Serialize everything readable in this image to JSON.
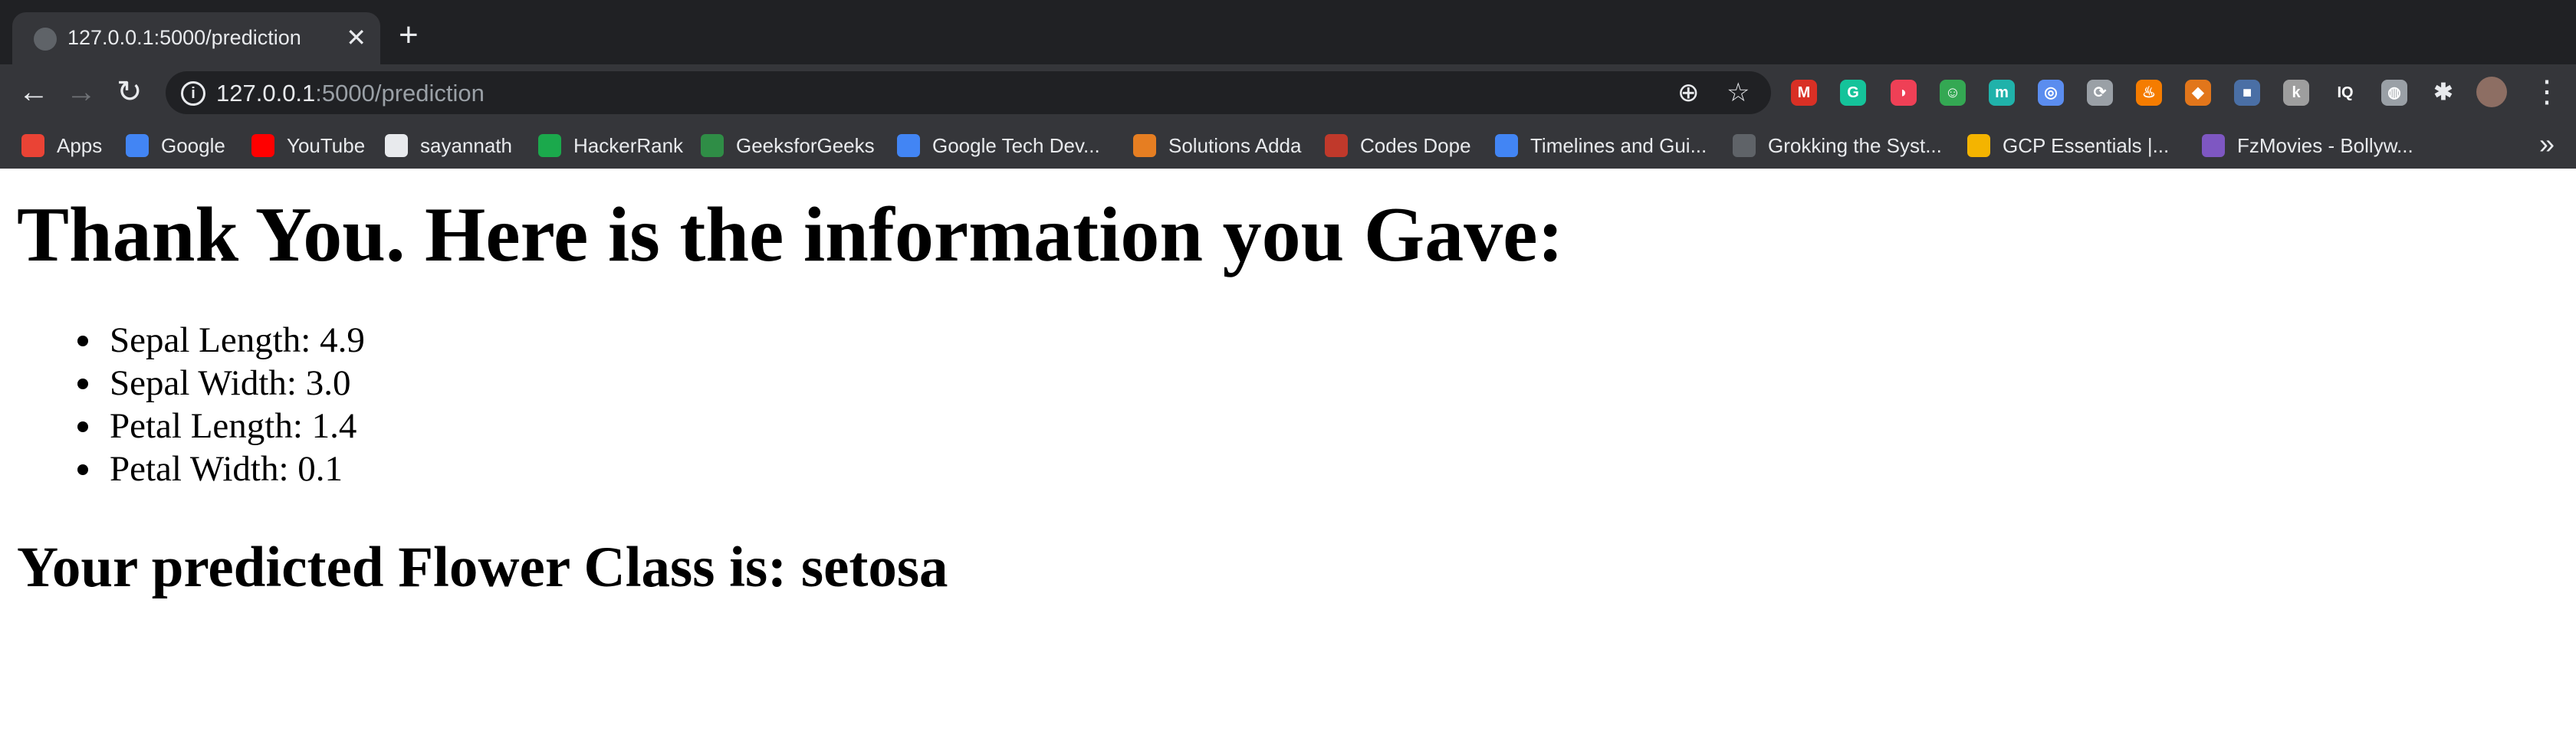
{
  "tab": {
    "title": "127.0.0.1:5000/prediction",
    "close_glyph": "✕",
    "new_tab_glyph": "+"
  },
  "toolbar": {
    "back_glyph": "←",
    "forward_glyph": "→",
    "reload_glyph": "↻",
    "info_glyph": "i",
    "url_host": "127.0.0.1",
    "url_rest": ":5000/prediction",
    "zoom_glyph": "⊕",
    "star_glyph": "☆",
    "extensions_glyph": "✱",
    "menu_glyph": "⋮"
  },
  "extensions": [
    {
      "icon": "gmail-extension-icon",
      "color": "#d93025",
      "glyph": "M"
    },
    {
      "icon": "grammarly-extension-icon",
      "color": "#15c39a",
      "glyph": "G"
    },
    {
      "icon": "pocket-extension-icon",
      "color": "#ef4056",
      "glyph": "◗"
    },
    {
      "icon": "clipboard-extension-icon",
      "color": "#34a853",
      "glyph": "☺"
    },
    {
      "icon": "m-extension-icon",
      "color": "#20b2aa",
      "glyph": "m"
    },
    {
      "icon": "mask-extension-icon",
      "color": "#5b8def",
      "glyph": "◎"
    },
    {
      "icon": "link-extension-icon",
      "color": "#9aa0a6",
      "glyph": "⟳"
    },
    {
      "icon": "fire-extension-icon",
      "color": "#f57c00",
      "glyph": "♨"
    },
    {
      "icon": "metamask-extension-icon",
      "color": "#e2761b",
      "glyph": "◆"
    },
    {
      "icon": "box-extension-icon",
      "color": "#4a6fa5",
      "glyph": "■"
    },
    {
      "icon": "k-extension-icon",
      "color": "#9e9e9e",
      "glyph": "k"
    },
    {
      "icon": "iq-extension-icon",
      "color": "#35363a",
      "glyph": "IQ"
    },
    {
      "icon": "globe-extension-icon",
      "color": "#9aa0a6",
      "glyph": "◍"
    }
  ],
  "bookmarks": [
    {
      "label": "Apps",
      "icon": "apps-grid-icon",
      "color": "#ea4335"
    },
    {
      "label": "Google",
      "icon": "google-icon",
      "color": "#4285f4"
    },
    {
      "label": "YouTube",
      "icon": "youtube-icon",
      "color": "#ff0000"
    },
    {
      "label": "sayannath",
      "icon": "github-icon",
      "color": "#e8eaed"
    },
    {
      "label": "HackerRank",
      "icon": "hackerrank-icon",
      "color": "#1ba94c"
    },
    {
      "label": "GeeksforGeeks",
      "icon": "geeksforgeeks-icon",
      "color": "#2f8d46"
    },
    {
      "label": "Google Tech Dev...",
      "icon": "google-icon",
      "color": "#4285f4"
    },
    {
      "label": "Solutions Adda",
      "icon": "solutions-adda-icon",
      "color": "#e67e22"
    },
    {
      "label": "Codes Dope",
      "icon": "codesdope-icon",
      "color": "#c0392b"
    },
    {
      "label": "Timelines and Gui...",
      "icon": "docs-icon",
      "color": "#4285f4"
    },
    {
      "label": "Grokking the Syst...",
      "icon": "terminal-icon",
      "color": "#5f6368"
    },
    {
      "label": "GCP Essentials |...",
      "icon": "qwiklabs-icon",
      "color": "#f4b400"
    },
    {
      "label": "FzMovies - Bollyw...",
      "icon": "fzmovies-icon",
      "color": "#7e57c2"
    }
  ],
  "bookmarks_more": "»",
  "page": {
    "heading": "Thank You. Here is the information you Gave:",
    "features": [
      "Sepal Length: 4.9",
      "Sepal Width: 3.0",
      "Petal Length: 1.4",
      "Petal Width: 0.1"
    ],
    "result": "Your predicted Flower Class is: setosa"
  }
}
